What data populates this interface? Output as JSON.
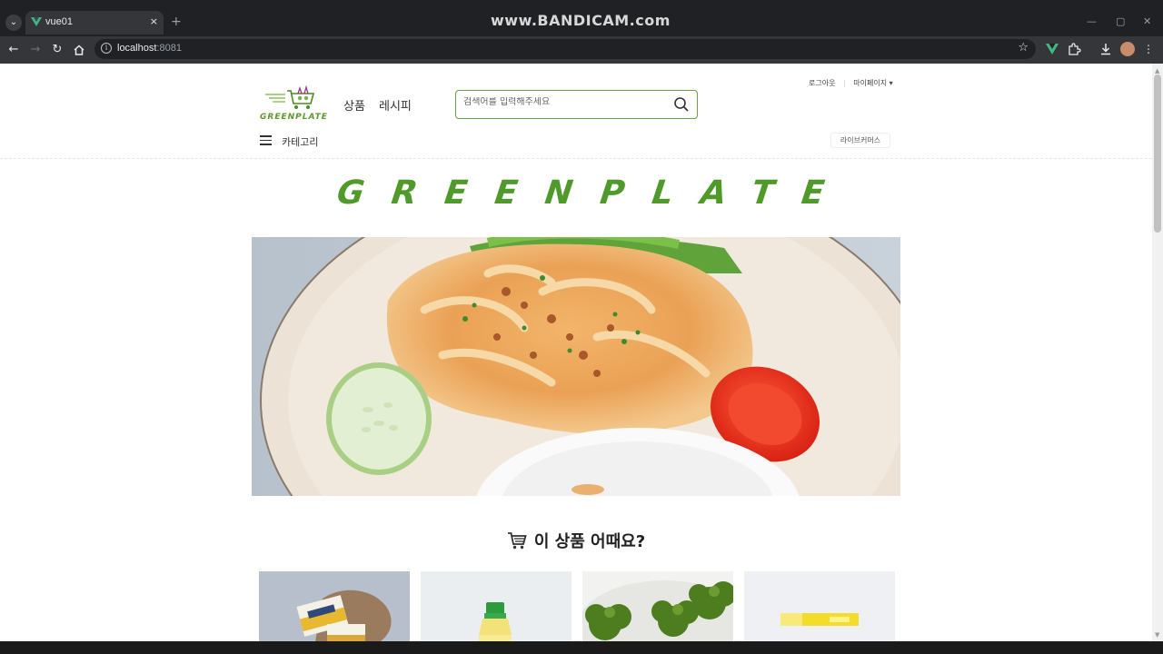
{
  "browser": {
    "tab_title": "vue01",
    "tab_close": "×",
    "new_tab": "+",
    "watermark": "www.BANDICAM.com",
    "url_host": "localhost",
    "url_port": ":8081"
  },
  "header": {
    "util_links": [
      "로그아웃",
      "마이페이지 ▾"
    ],
    "logo_text": "GREENPLATE",
    "nav": [
      "상품",
      "레시피"
    ],
    "search_placeholder": "검색어를 입력해주세요",
    "category_label": "카테고리",
    "live_commerce": "라이브커머스"
  },
  "banner": {
    "brand_word": "GREENPLATE"
  },
  "section": {
    "title": "이 상품 어때요?"
  },
  "colors": {
    "brand_green": "#5a9a2e",
    "search_border": "#6aa339"
  },
  "products": [
    {
      "name": "cheese-package-image"
    },
    {
      "name": "sauce-bottle-image"
    },
    {
      "name": "broccoli-image"
    },
    {
      "name": "stick-pack-image"
    }
  ]
}
